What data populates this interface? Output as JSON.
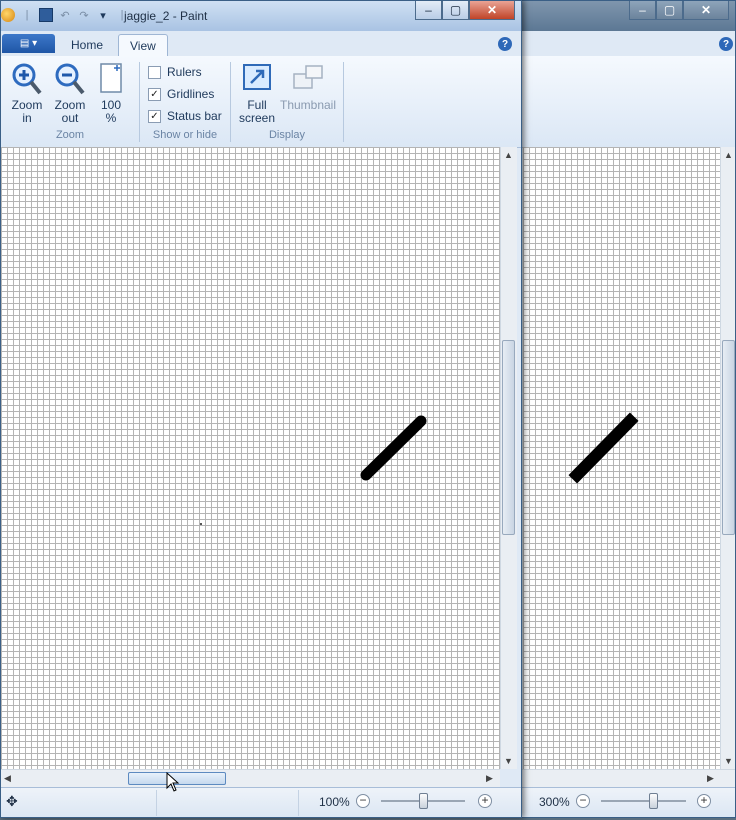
{
  "window": {
    "title": "jaggie_2 - Paint"
  },
  "tabs": {
    "home": "Home",
    "view": "View"
  },
  "help": "?",
  "ribbon": {
    "zoom": {
      "label": "Zoom",
      "zoom_in": "Zoom\nin",
      "zoom_out": "Zoom\nout",
      "hundred": "100\n%"
    },
    "show_hide": {
      "label": "Show or hide",
      "rulers": "Rulers",
      "rulers_checked": false,
      "gridlines": "Gridlines",
      "gridlines_checked": true,
      "status_bar": "Status bar",
      "status_bar_checked": true
    },
    "display": {
      "label": "Display",
      "full_screen": "Full\nscreen",
      "thumbnail": "Thumbnail"
    }
  },
  "status": {
    "front_zoom": "100%",
    "back_zoom": "300%",
    "front_zoom_level": 0.5,
    "back_zoom_level": 0.5
  },
  "icons": [
    "app-icon",
    "save-icon",
    "undo-icon",
    "redo-icon",
    "customize-icon",
    "minimize-icon",
    "maximize-icon",
    "close-icon",
    "zoom-in-icon",
    "zoom-out-icon",
    "page-icon",
    "full-screen-icon",
    "thumbnail-icon",
    "move-icon"
  ]
}
